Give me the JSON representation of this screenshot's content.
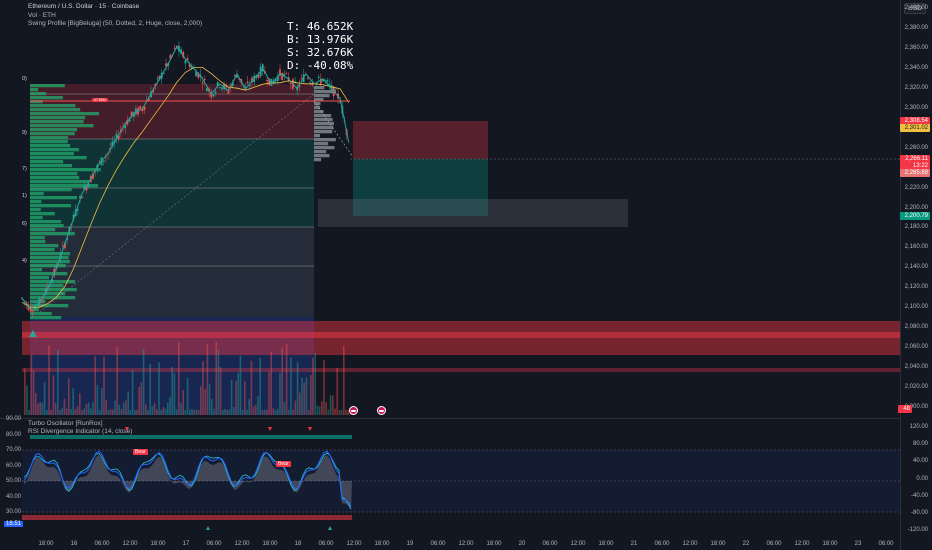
{
  "header": {
    "symbol_line": "Ethereum / U.S. Dollar · 15 · Coinbase",
    "volume_line": "Vol · ETH",
    "indicator_line": "Swing Profile [BigBeluga] (50, Dotted, 2, Huge, close, 2,000)"
  },
  "stats": {
    "total": "T: 46.652K",
    "buy": "B: 13.976K",
    "sell": "S: 32.676K",
    "delta": "D: -40.08%"
  },
  "currency_button": "USD",
  "price_axis": [
    "2,400.00",
    "2,380.00",
    "2,360.00",
    "2,340.00",
    "2,320.00",
    "2,300.00",
    "2,280.00",
    "2,260.00",
    "2,240.00",
    "2,220.00",
    "2,200.00",
    "2,180.00",
    "2,160.00",
    "2,140.00",
    "2,120.00",
    "2,100.00",
    "2,080.00",
    "2,060.00",
    "2,040.00",
    "2,020.00",
    "2,000.00"
  ],
  "price_tags": {
    "red_upper": "2,308.54",
    "yellow": "2,301.02",
    "current_price": "2,266.11",
    "countdown": "13:22",
    "current_low": "2,265.69",
    "teal": "2,200.79",
    "volume": "48"
  },
  "colors": {
    "background": "#131722",
    "bull": "#089981",
    "bear": "#f23645",
    "price_line": "#ef5350",
    "ma_line": "#f0c040",
    "rsi_blue": "#2962ff",
    "volume_profile": "#22ab6c"
  },
  "oscillator": {
    "title_1": "Turbo Oscillator [RunRox]",
    "title_2": "RSI Divergence Indicator (14, close)",
    "left_axis": [
      "90.00",
      "80.00",
      "70.00",
      "60.00",
      "50.00",
      "40.00",
      "30.00"
    ],
    "right_axis": [
      "120.00",
      "80.00",
      "40.00",
      "0.00",
      "-40.00",
      "-80.00",
      "-120.00"
    ],
    "current_value_badge": "18.51",
    "labels": {
      "bear1": "Bear",
      "bear2": "Bear"
    }
  },
  "time_axis": [
    "18:00",
    "16",
    "06:00",
    "12:00",
    "18:00",
    "17",
    "06:00",
    "12:00",
    "18:00",
    "18",
    "06:00",
    "12:00",
    "18:00",
    "19",
    "06:00",
    "12:00",
    "18:00",
    "20",
    "06:00",
    "12:00",
    "18:00",
    "21",
    "06:00",
    "12:00",
    "18:00",
    "22",
    "06:00",
    "12:00",
    "18:00",
    "23",
    "06:00"
  ],
  "profile_tags": {
    "poc": "47.66M"
  },
  "left_markers": [
    "0)",
    "9)",
    "7)",
    "1)",
    "6)",
    "4)"
  ],
  "chart_data": {
    "type": "candlestick",
    "title": "Ethereum / U.S. Dollar · 15 · Coinbase",
    "ylim": [
      1990,
      2410
    ],
    "y_ticks": [
      2000,
      2020,
      2040,
      2060,
      2080,
      2100,
      2120,
      2140,
      2160,
      2180,
      2200,
      2220,
      2240,
      2260,
      2280,
      2300,
      2320,
      2340,
      2360,
      2380,
      2400
    ],
    "price_path": [
      [
        0,
        2110
      ],
      [
        4,
        2100
      ],
      [
        8,
        2105
      ],
      [
        12,
        2120
      ],
      [
        16,
        2140
      ],
      [
        20,
        2165
      ],
      [
        24,
        2190
      ],
      [
        28,
        2215
      ],
      [
        32,
        2230
      ],
      [
        36,
        2245
      ],
      [
        40,
        2255
      ],
      [
        44,
        2270
      ],
      [
        48,
        2285
      ],
      [
        52,
        2295
      ],
      [
        56,
        2300
      ],
      [
        60,
        2315
      ],
      [
        64,
        2330
      ],
      [
        68,
        2345
      ],
      [
        72,
        2362
      ],
      [
        76,
        2350
      ],
      [
        80,
        2340
      ],
      [
        84,
        2330
      ],
      [
        88,
        2315
      ],
      [
        92,
        2325
      ],
      [
        96,
        2318
      ],
      [
        100,
        2335
      ],
      [
        104,
        2320
      ],
      [
        108,
        2330
      ],
      [
        112,
        2340
      ],
      [
        116,
        2325
      ],
      [
        120,
        2335
      ],
      [
        124,
        2330
      ],
      [
        128,
        2320
      ],
      [
        132,
        2335
      ],
      [
        136,
        2325
      ],
      [
        140,
        2330
      ],
      [
        144,
        2320
      ],
      [
        148,
        2310
      ],
      [
        152,
        2266
      ]
    ],
    "levels": {
      "profile_top": 2345,
      "poc": 2330,
      "profile_bottom": 2090,
      "swing_high": 2362,
      "resistance_zone": [
        2050,
        2080
      ],
      "last_price": 2266.11
    }
  }
}
